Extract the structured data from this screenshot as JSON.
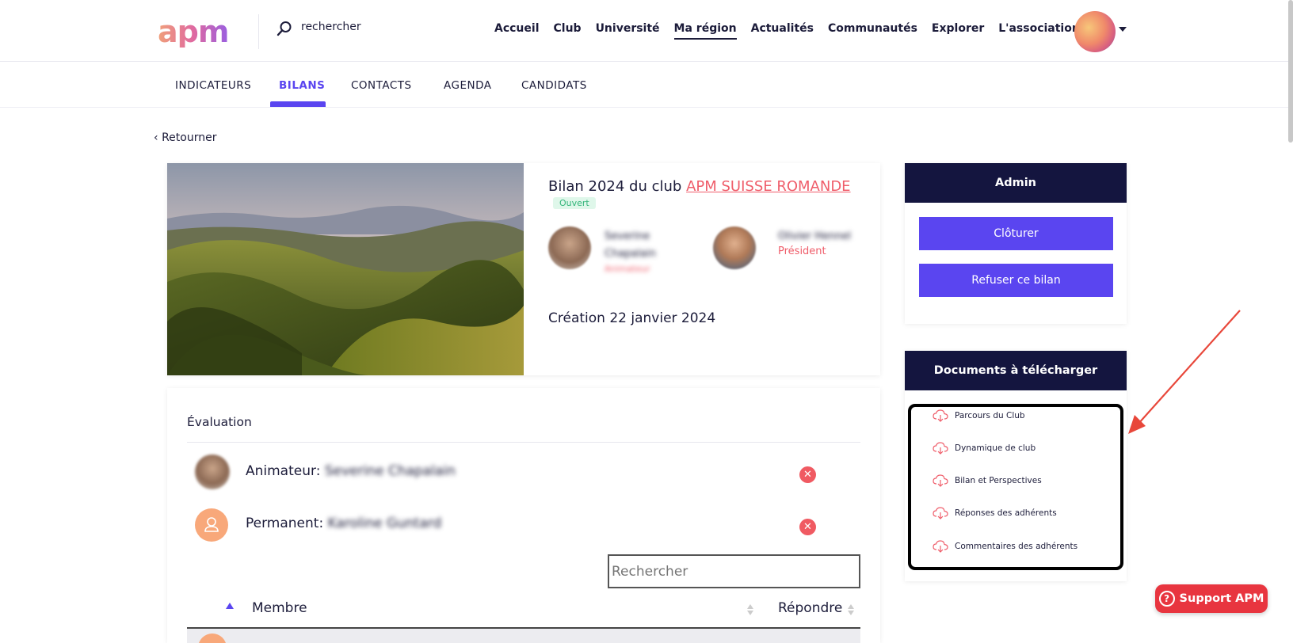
{
  "header": {
    "logo": "apm",
    "search_text": "rechercher",
    "nav": [
      "Accueil",
      "Club",
      "Université",
      "Ma région",
      "Actualités",
      "Communautés",
      "Explorer",
      "L'association"
    ],
    "active_nav": "Ma région"
  },
  "subnav": {
    "tabs": [
      "INDICATEURS",
      "BILANS",
      "CONTACTS",
      "AGENDA",
      "CANDIDATS"
    ],
    "active": "BILANS"
  },
  "back_label": "Retourner",
  "bilan": {
    "title_prefix": "Bilan 2024 du club ",
    "club_name": "APM SUISSE ROMANDE",
    "status": "Ouvert",
    "person1_name_line1": "Severine",
    "person1_name_line2": "Chapalain",
    "person1_role": "Animateur",
    "person2_name": "Olivier Hennel",
    "person2_role": "Président",
    "creation": "Création 22 janvier 2024"
  },
  "evaluation": {
    "title": "Évaluation",
    "animateur_label": "Animateur:",
    "animateur_name": "Severine Chapalain",
    "permanent_label": "Permanent:",
    "permanent_name": "Karoline Guntard",
    "search_placeholder": "Rechercher",
    "col_member": "Membre",
    "col_respond": "Répondre"
  },
  "admin": {
    "title": "Admin",
    "close_label": "Clôturer",
    "refuse_label": "Refuser ce bilan"
  },
  "documents": {
    "title": "Documents à télécharger",
    "items": [
      "Parcours du Club",
      "Dynamique de club",
      "Bilan et Perspectives",
      "Réponses des adhérents",
      "Commentaires des adhérents"
    ]
  },
  "support_label": "Support APM",
  "colors": {
    "accent": "#5a45f0",
    "navy": "#14153f",
    "link": "#ef5d6a",
    "danger": "#e8353f"
  }
}
